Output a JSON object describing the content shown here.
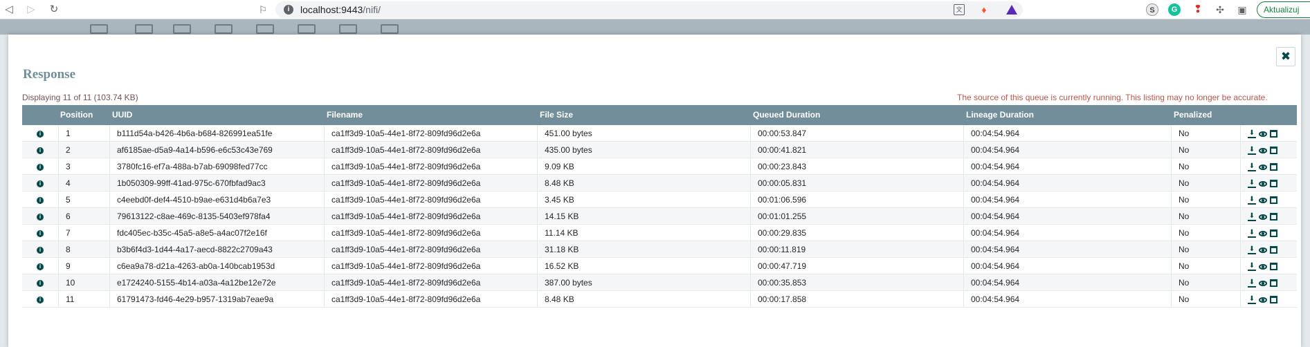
{
  "browser": {
    "url_host": "localhost:9443",
    "url_path": "/nifi/",
    "update_label": "Aktualizuj"
  },
  "dialog": {
    "title": "Response",
    "close_label": "✖",
    "display_count": "Displaying 11 of 11 (103.74 KB)",
    "warning": "The source of this queue is currently running. This listing may no longer be accurate."
  },
  "table": {
    "headers": {
      "position": "Position",
      "uuid": "UUID",
      "filename": "Filename",
      "file_size": "File Size",
      "queued": "Queued Duration",
      "lineage": "Lineage Duration",
      "penalized": "Penalized"
    },
    "rows": [
      {
        "position": "1",
        "uuid": "b111d54a-b426-4b6a-b684-826991ea51fe",
        "filename": "ca1ff3d9-10a5-44e1-8f72-809fd96d2e6a",
        "size": "451.00 bytes",
        "queued": "00:00:53.847",
        "lineage": "00:04:54.964",
        "penalized": "No"
      },
      {
        "position": "2",
        "uuid": "af6185ae-d5a9-4a14-b596-e6c53c43e769",
        "filename": "ca1ff3d9-10a5-44e1-8f72-809fd96d2e6a",
        "size": "435.00 bytes",
        "queued": "00:00:41.821",
        "lineage": "00:04:54.964",
        "penalized": "No"
      },
      {
        "position": "3",
        "uuid": "3780fc16-ef7a-488a-b7ab-69098fed77cc",
        "filename": "ca1ff3d9-10a5-44e1-8f72-809fd96d2e6a",
        "size": "9.09 KB",
        "queued": "00:00:23.843",
        "lineage": "00:04:54.964",
        "penalized": "No"
      },
      {
        "position": "4",
        "uuid": "1b050309-99ff-41ad-975c-670fbfad9ac3",
        "filename": "ca1ff3d9-10a5-44e1-8f72-809fd96d2e6a",
        "size": "8.48 KB",
        "queued": "00:00:05.831",
        "lineage": "00:04:54.964",
        "penalized": "No"
      },
      {
        "position": "5",
        "uuid": "c4eebd0f-def4-4510-b9ae-e631d4b6a7e3",
        "filename": "ca1ff3d9-10a5-44e1-8f72-809fd96d2e6a",
        "size": "3.45 KB",
        "queued": "00:01:06.596",
        "lineage": "00:04:54.964",
        "penalized": "No"
      },
      {
        "position": "6",
        "uuid": "79613122-c8ae-469c-8135-5403ef978fa4",
        "filename": "ca1ff3d9-10a5-44e1-8f72-809fd96d2e6a",
        "size": "14.15 KB",
        "queued": "00:01:01.255",
        "lineage": "00:04:54.964",
        "penalized": "No"
      },
      {
        "position": "7",
        "uuid": "fdc405ec-b35c-45a5-a8e5-a4ac07f2e16f",
        "filename": "ca1ff3d9-10a5-44e1-8f72-809fd96d2e6a",
        "size": "11.14 KB",
        "queued": "00:00:29.835",
        "lineage": "00:04:54.964",
        "penalized": "No"
      },
      {
        "position": "8",
        "uuid": "b3b6f4d3-1d44-4a17-aecd-8822c2709a43",
        "filename": "ca1ff3d9-10a5-44e1-8f72-809fd96d2e6a",
        "size": "31.18 KB",
        "queued": "00:00:11.819",
        "lineage": "00:04:54.964",
        "penalized": "No"
      },
      {
        "position": "9",
        "uuid": "c6ea9a78-d21a-4263-ab0a-140bcab1953d",
        "filename": "ca1ff3d9-10a5-44e1-8f72-809fd96d2e6a",
        "size": "16.52 KB",
        "queued": "00:00:47.719",
        "lineage": "00:04:54.964",
        "penalized": "No"
      },
      {
        "position": "10",
        "uuid": "e1724240-5155-4b14-a03a-4a12be12e72e",
        "filename": "ca1ff3d9-10a5-44e1-8f72-809fd96d2e6a",
        "size": "387.00 bytes",
        "queued": "00:00:35.853",
        "lineage": "00:04:54.964",
        "penalized": "No"
      },
      {
        "position": "11",
        "uuid": "61791473-fd46-4e29-b957-1319ab7eae9a",
        "filename": "ca1ff3d9-10a5-44e1-8f72-809fd96d2e6a",
        "size": "8.48 KB",
        "queued": "00:00:17.858",
        "lineage": "00:04:54.964",
        "penalized": "No"
      }
    ]
  },
  "icons": {
    "info": "info-icon",
    "download": "download-icon",
    "view": "eye-icon",
    "provenance": "provenance-icon"
  },
  "colors": {
    "header_bg": "#728e9b",
    "accent": "#004849",
    "warning": "#ba554a"
  }
}
